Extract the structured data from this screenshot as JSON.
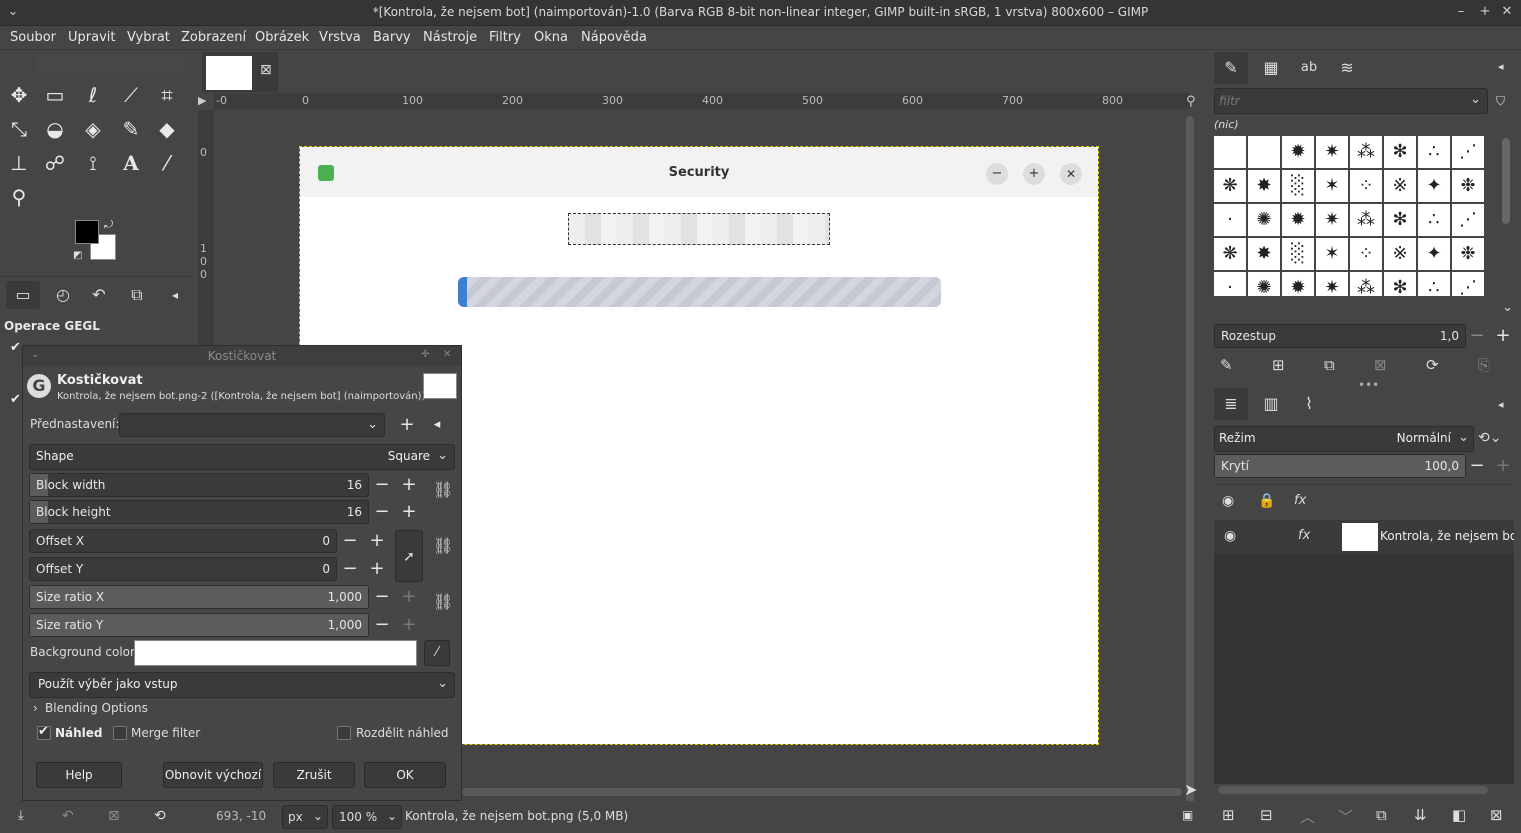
{
  "window": {
    "title": "*[Kontrola, že nejsem bot] (naimportován)-1.0 (Barva RGB 8-bit non-linear integer, GIMP built-in sRGB, 1 vrstva) 800x600 – GIMP",
    "menu_icon": "chevron-down-icon",
    "minimize": "–",
    "maximize": "+",
    "close": "✕"
  },
  "menu": [
    "Soubor",
    "Upravit",
    "Vybrat",
    "Zobrazení",
    "Obrázek",
    "Vrstva",
    "Barvy",
    "Nástroje",
    "Filtry",
    "Okna",
    "Nápověda"
  ],
  "toolbox": {
    "gegl_title": "Operace GEGL"
  },
  "rulers": {
    "h_ticks": [
      "-0",
      "0",
      "100",
      "200",
      "300",
      "400",
      "500",
      "600",
      "700",
      "800"
    ],
    "v_ticks": [
      "0",
      "1",
      "0",
      "0"
    ]
  },
  "canvas": {
    "app_title": "Security",
    "btn_min": "−",
    "btn_max": "+",
    "btn_close": "✕"
  },
  "dialog": {
    "window_title": "Kostičkovat",
    "heading": "Kostičkovat",
    "subtitle": "Kontrola, že nejsem bot.png-2 ([Kontrola, že nejsem bot] (naimportován))",
    "presets_label": "Přednastavení:",
    "shape_label": "Shape",
    "shape_value": "Square",
    "block_width_label": "Block width",
    "block_width_value": "16",
    "block_height_label": "Block height",
    "block_height_value": "16",
    "offset_x_label": "Offset X",
    "offset_x_value": "0",
    "offset_y_label": "Offset Y",
    "offset_y_value": "0",
    "size_ratio_x_label": "Size ratio X",
    "size_ratio_x_value": "1,000",
    "size_ratio_y_label": "Size ratio Y",
    "size_ratio_y_value": "1,000",
    "bg_color_label": "Background color",
    "input_mode": "Použít výběr jako vstup",
    "blending": "Blending Options",
    "preview_label": "Náhled",
    "merge_label": "Merge filter",
    "split_label": "Rozdělit náhled",
    "btn_help": "Help",
    "btn_reset": "Obnovit výchozí",
    "btn_cancel": "Zrušit",
    "btn_ok": "OK"
  },
  "statusbar": {
    "coords": "693, -10",
    "unit": "px",
    "zoom": "100 %",
    "file_info": "Kontrola, že nejsem bot.png (5,0 MB)"
  },
  "brushes": {
    "filter_placeholder": "filtr",
    "selected_name": "(nic)",
    "spacing_label": "Rozestup",
    "spacing_value": "1,0"
  },
  "layers": {
    "mode_label": "Režim",
    "mode_value": "Normální",
    "opacity_label": "Krytí",
    "opacity_value": "100,0",
    "layer_name": "Kontrola, že nejsem bot.png"
  },
  "colors": {
    "fg": "#000000",
    "bg": "#ffffff",
    "progress_accent": "#3f7fd0"
  }
}
